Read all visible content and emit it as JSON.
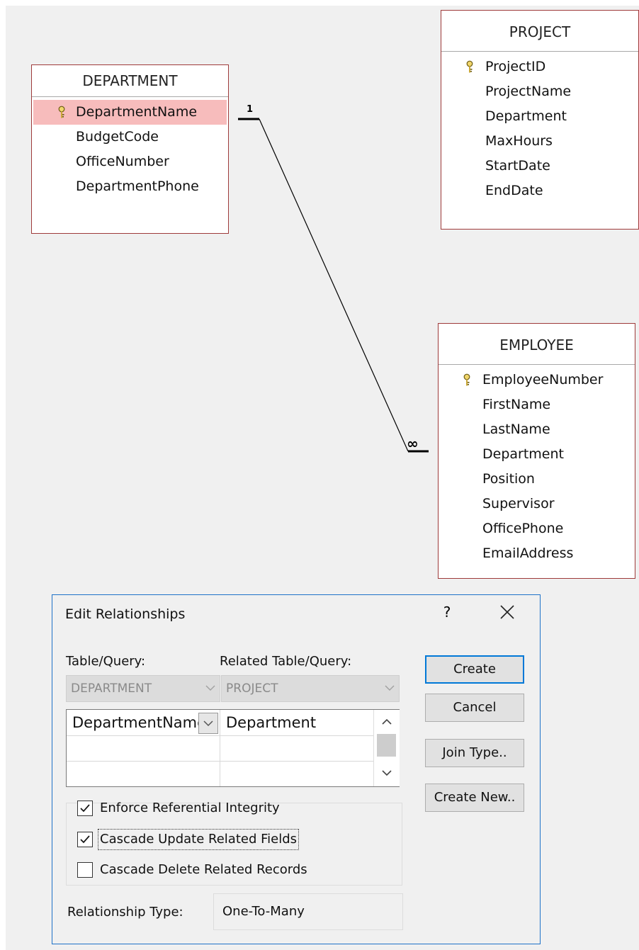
{
  "tables": {
    "project": {
      "title": "PROJECT",
      "fields": [
        "ProjectID",
        "ProjectName",
        "Department",
        "MaxHours",
        "StartDate",
        "EndDate"
      ]
    },
    "department": {
      "title": "DEPARTMENT",
      "fields": [
        "DepartmentName",
        "BudgetCode",
        "OfficeNumber",
        "DepartmentPhone"
      ]
    },
    "employee": {
      "title": "EMPLOYEE",
      "fields": [
        "EmployeeNumber",
        "FirstName",
        "LastName",
        "Department",
        "Position",
        "Supervisor",
        "OfficePhone",
        "EmailAddress"
      ]
    }
  },
  "relationship_line": {
    "one_label": "1",
    "many_label": "∞"
  },
  "dialog": {
    "title": "Edit Relationships",
    "help": "?",
    "table_query_label": "Table/Query:",
    "related_table_label": "Related Table/Query:",
    "table_value": "DEPARTMENT",
    "related_value": "PROJECT",
    "grid_rows": [
      {
        "left": "DepartmentName",
        "right": "Department"
      },
      {
        "left": "",
        "right": ""
      },
      {
        "left": "",
        "right": ""
      }
    ],
    "checkboxes": [
      {
        "label": "Enforce Referential Integrity",
        "checked": true
      },
      {
        "label": "Cascade Update Related Fields",
        "checked": true
      },
      {
        "label": "Cascade Delete Related Records",
        "checked": false
      }
    ],
    "relationship_type_label": "Relationship Type:",
    "relationship_type_value": "One-To-Many",
    "buttons": {
      "create": "Create",
      "cancel": "Cancel",
      "join_type": "Join Type..",
      "create_new": "Create New.."
    }
  }
}
